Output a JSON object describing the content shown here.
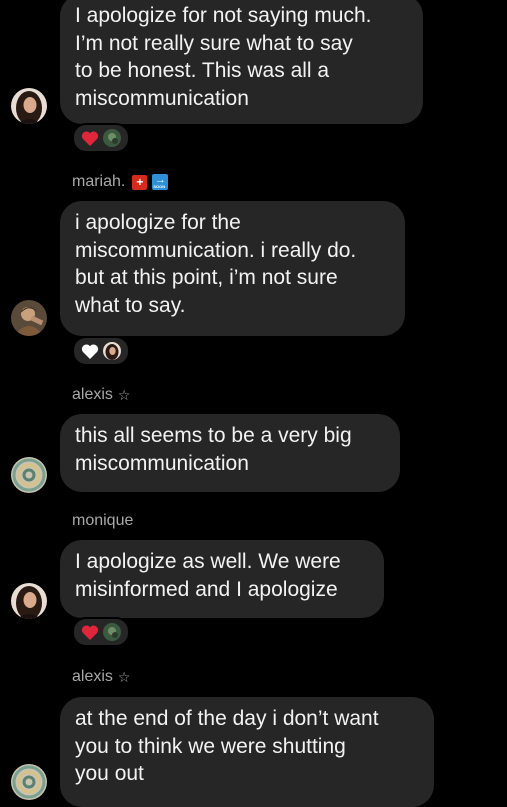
{
  "messages": [
    {
      "sender": "",
      "lines": [
        "I apologize for not saying much.",
        "I’m not really sure what to say",
        "to be honest. This was all a",
        "miscommunication"
      ],
      "reactions": [
        "red-heart-icon",
        "reactor-avatar-green"
      ]
    },
    {
      "sender": "mariah.",
      "sender_badges": [
        "+",
        "→"
      ],
      "lines": [
        "i apologize for the",
        "miscommunication. i really do.",
        "but at this point, i’m not sure",
        "what to say."
      ],
      "reactions": [
        "white-heart-icon",
        "reactor-avatar-woman"
      ]
    },
    {
      "sender": "alexis",
      "sender_suffix": "☆",
      "lines": [
        "this all seems to be a very big",
        "miscommunication"
      ]
    },
    {
      "sender": "monique",
      "lines": [
        "I apologize as well. We were",
        "misinformed and I apologize"
      ],
      "reactions": [
        "red-heart-icon",
        "reactor-avatar-green"
      ]
    },
    {
      "sender": "alexis",
      "sender_suffix": "☆",
      "lines": [
        "at the end of the day i don’t want",
        "you to think we were shutting",
        "you out"
      ]
    }
  ],
  "badge_soon_text": "SOON",
  "colors": {
    "background": "#000000",
    "bubble": "#262626",
    "text": "#f2f2f2",
    "sender": "#a8a8a8",
    "heart_red": "#e0263a"
  }
}
